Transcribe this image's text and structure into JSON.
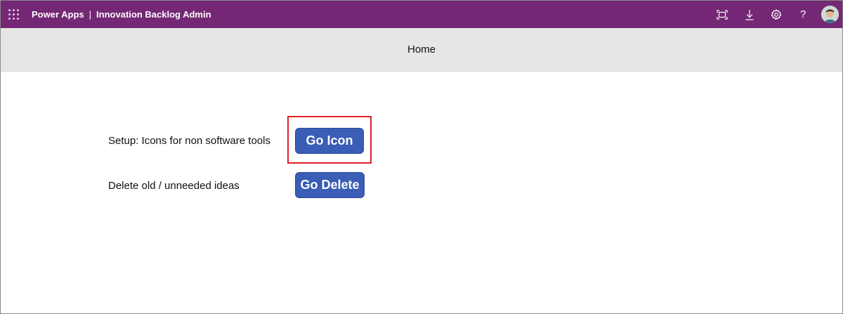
{
  "topbar": {
    "product": "Power Apps",
    "separator": "|",
    "app_name": "Innovation Backlog Admin",
    "icons": [
      "waffle-icon",
      "fit-to-screen-icon",
      "download-icon",
      "settings-gear-icon",
      "help-icon",
      "avatar"
    ],
    "help_label": "?",
    "bg_color": "#742774"
  },
  "header": {
    "title": "Home"
  },
  "rows": [
    {
      "label": "Setup: Icons for non software tools",
      "button_label": "Go Icon",
      "highlighted": true
    },
    {
      "label": "Delete old / unneeded ideas",
      "button_label": "Go Delete",
      "highlighted": false
    }
  ],
  "colors": {
    "button_bg": "#3a5db5",
    "highlight_border": "#e0202b",
    "header_bg": "#e6e6e6"
  }
}
